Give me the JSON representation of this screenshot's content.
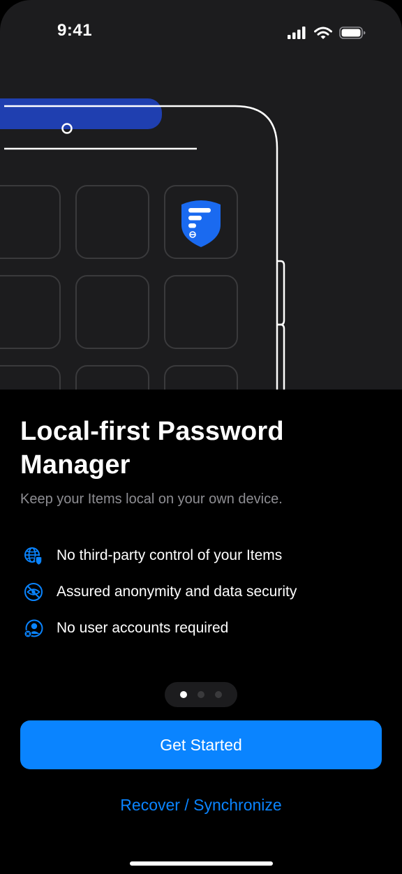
{
  "status": {
    "time": "9:41"
  },
  "onboarding": {
    "title": "Local-first Password Manager",
    "subtitle": "Keep your Items local on your own device.",
    "features": [
      {
        "icon": "globe-shield-icon",
        "label": "No third-party control of your Items"
      },
      {
        "icon": "eye-slash-icon",
        "label": "Assured anonymity and data security"
      },
      {
        "icon": "person-xmark-icon",
        "label": "No user accounts required"
      }
    ],
    "pager": {
      "count": 3,
      "active": 1
    },
    "primary_label": "Get Started",
    "secondary_label": "Recover / Synchronize"
  },
  "colors": {
    "accent": "#0a84ff",
    "hero_background": "#1c1c1e",
    "background": "#000000",
    "secondary_text": "#8e8e93",
    "brand_shield": "#1a6af0",
    "header_bar": "#1f3fb0"
  }
}
